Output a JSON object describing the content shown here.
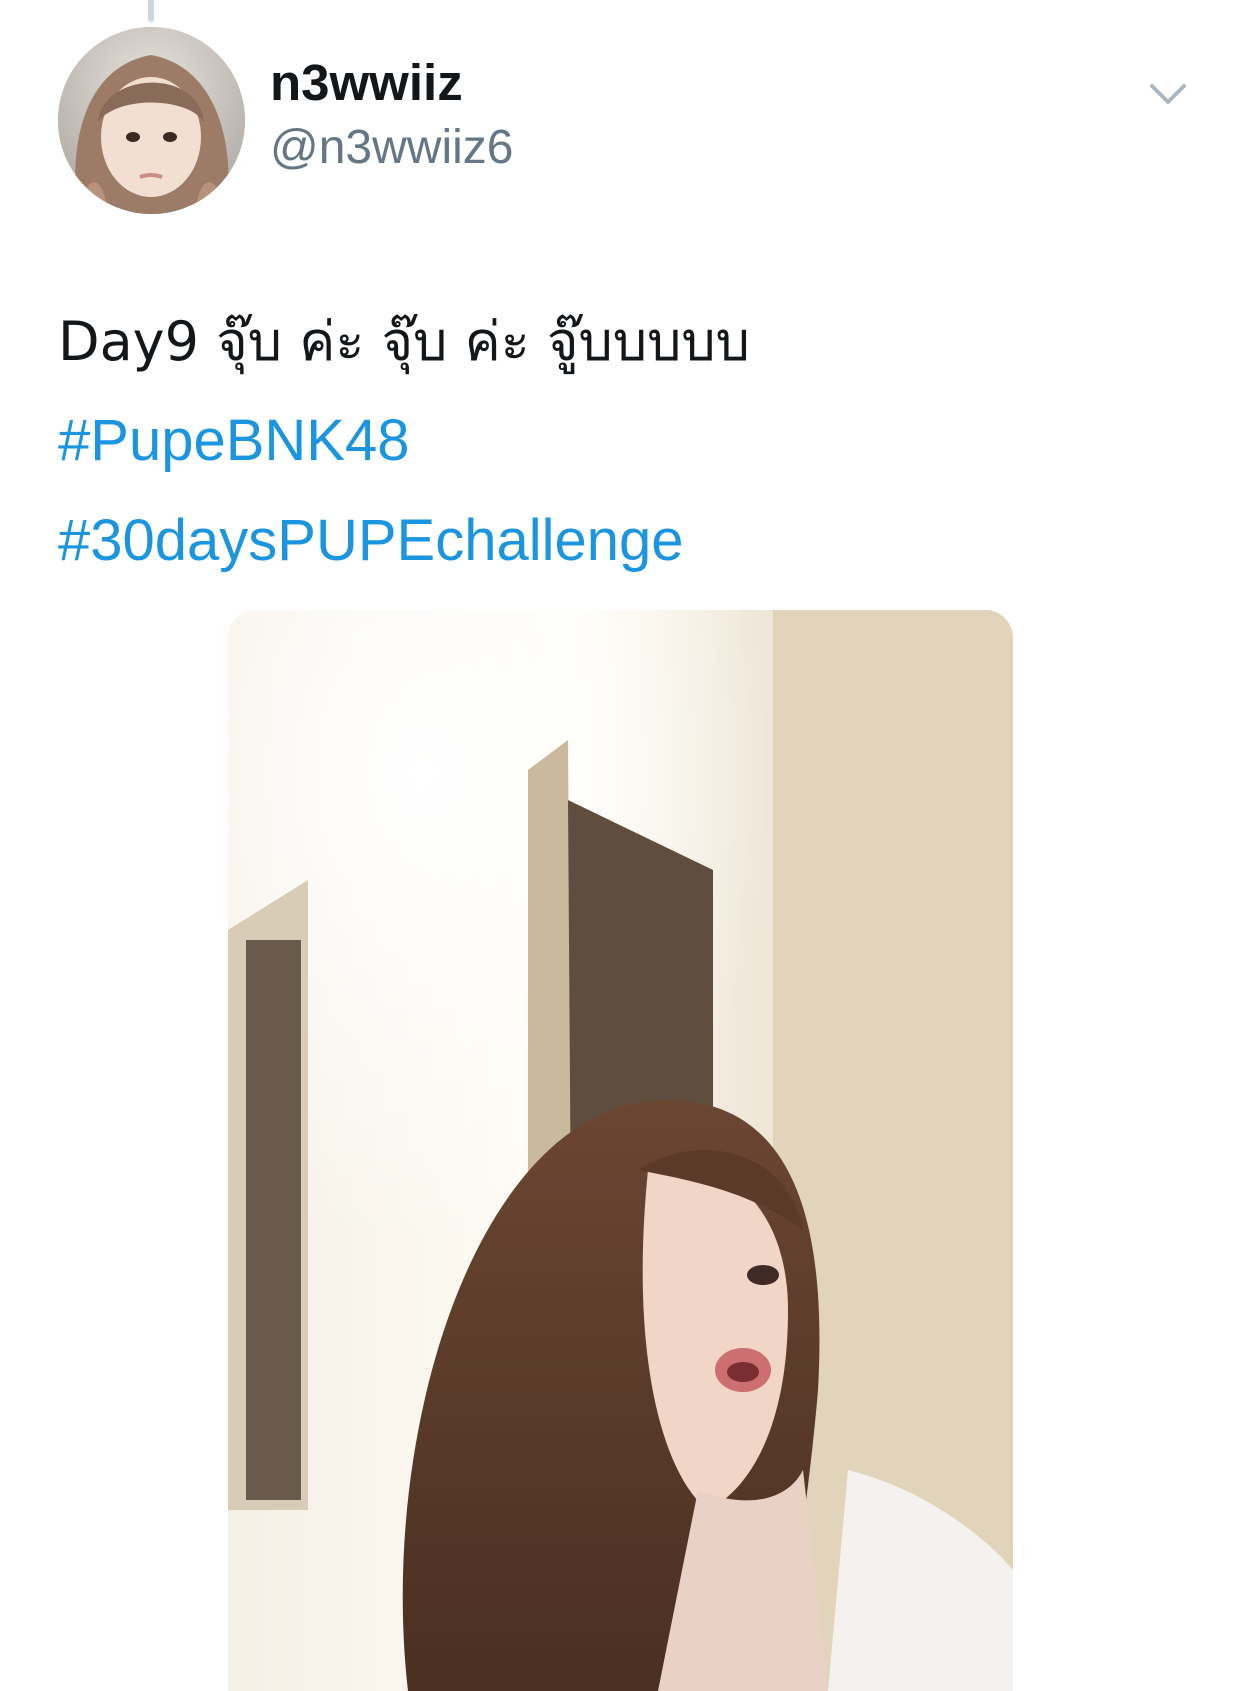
{
  "tweet": {
    "author": {
      "display_name": "n3wwiiz",
      "handle": "@n3wwiiz6"
    },
    "text": "Day9 จุ๊บ ค่ะ จุ๊บ ค่ะ จู๊บบบบบ",
    "hashtags": [
      "#PupeBNK48",
      "#30daysPUPEchallenge"
    ],
    "menu_icon": "chevron-down-icon",
    "media_type": "video-thumbnail"
  },
  "colors": {
    "text": "#14171a",
    "secondary": "#657786",
    "link": "#1b95e0",
    "thread_line": "#ccd6dd"
  }
}
